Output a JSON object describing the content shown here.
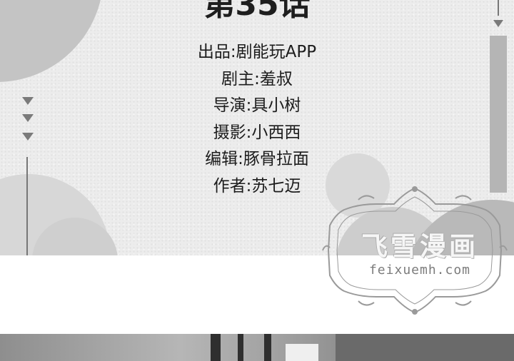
{
  "chapter_title": "第35话",
  "credits": [
    {
      "label": "出品",
      "name": "剧能玩APP"
    },
    {
      "label": "剧主",
      "name": "羞叔"
    },
    {
      "label": "导演",
      "name": "具小树"
    },
    {
      "label": "摄影",
      "name": "小西西"
    },
    {
      "label": "编辑",
      "name": "豚骨拉面"
    },
    {
      "label": "作者",
      "name": "苏七迈"
    }
  ],
  "credit_separator": ":",
  "watermark": {
    "title": "飞雪漫画",
    "url": "feixuemh.com"
  },
  "colors": {
    "paper": "#ececec",
    "text": "#1c1c1c",
    "accent_gray": "#b5b5b5"
  }
}
